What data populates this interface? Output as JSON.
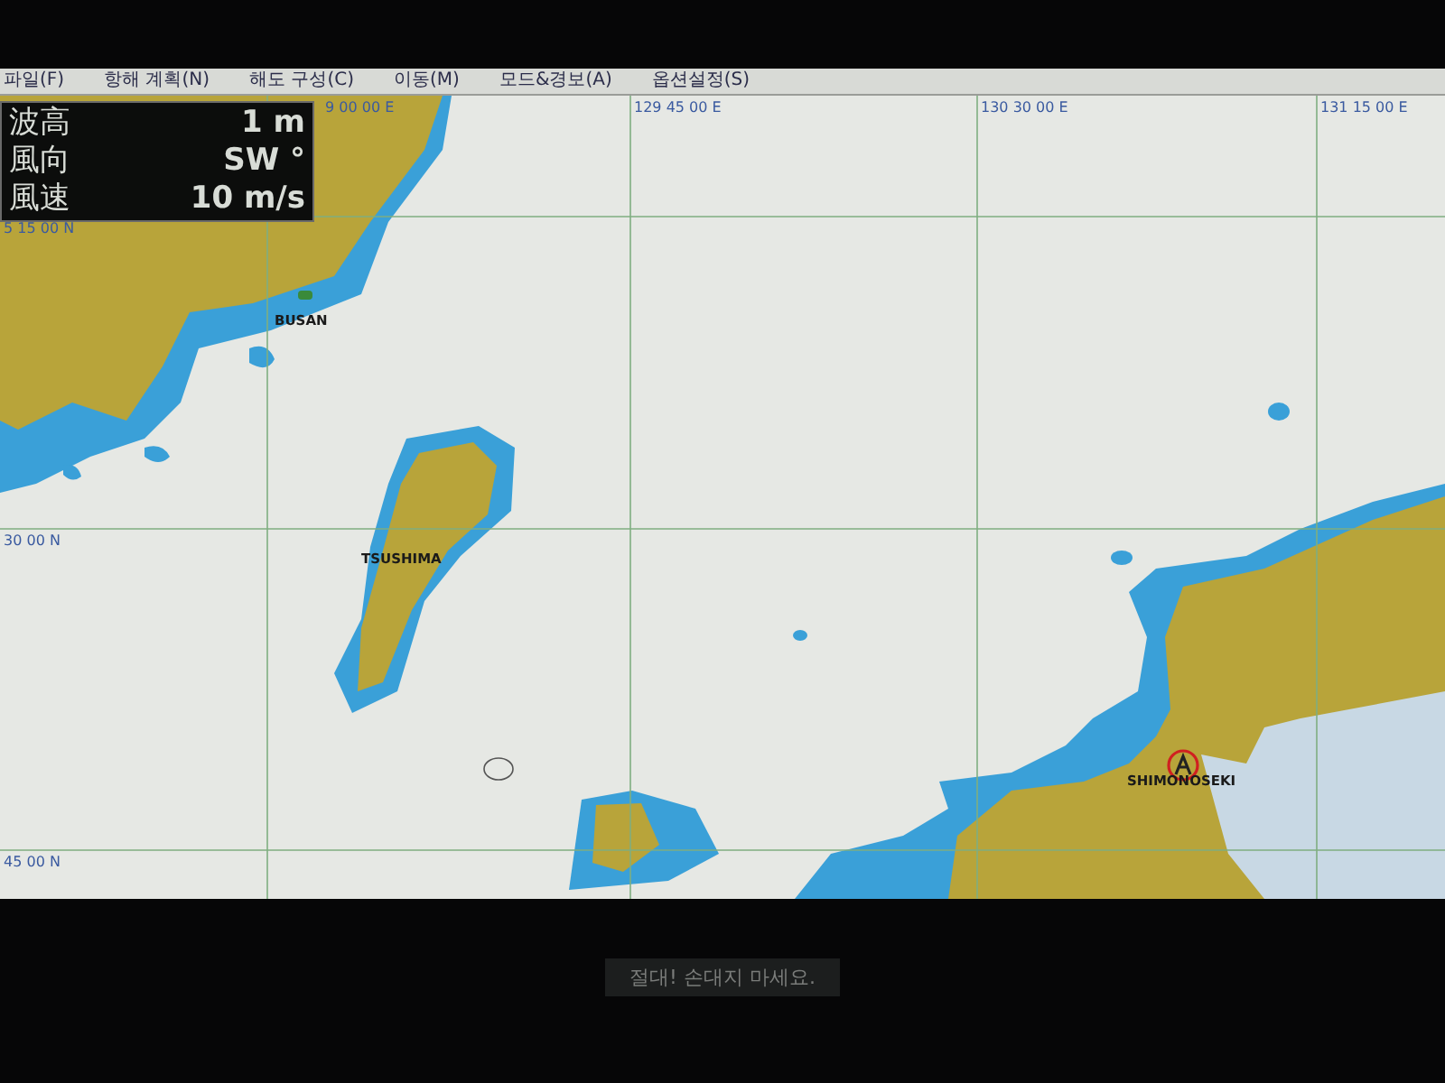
{
  "menu": [
    {
      "label": "파일(F)"
    },
    {
      "label": "항해 계획(N)"
    },
    {
      "label": "해도 구성(C)"
    },
    {
      "label": "이동(M)"
    },
    {
      "label": "모드&경보(A)"
    },
    {
      "label": "옵션설정(S)"
    }
  ],
  "info_panel": {
    "rows": [
      {
        "label": "波高",
        "value": "1 m"
      },
      {
        "label": "風向",
        "value": "SW °"
      },
      {
        "label": "風速",
        "value": "10 m/s"
      }
    ]
  },
  "chart": {
    "longitude_labels": [
      "9 00 00 E",
      "129 45 00 E",
      "130 30 00 E",
      "131 15 00 E"
    ],
    "latitude_labels": [
      "5 15 00 N",
      "30 00 N",
      "45 00 N"
    ],
    "places": [
      {
        "name": "BUSAN",
        "kind": "port"
      },
      {
        "name": "TSUSHIMA",
        "kind": "plain"
      },
      {
        "name": "SHIMONOSEKI",
        "kind": "anchor"
      }
    ]
  },
  "bezel_label": "절대! 손대지 마세요."
}
